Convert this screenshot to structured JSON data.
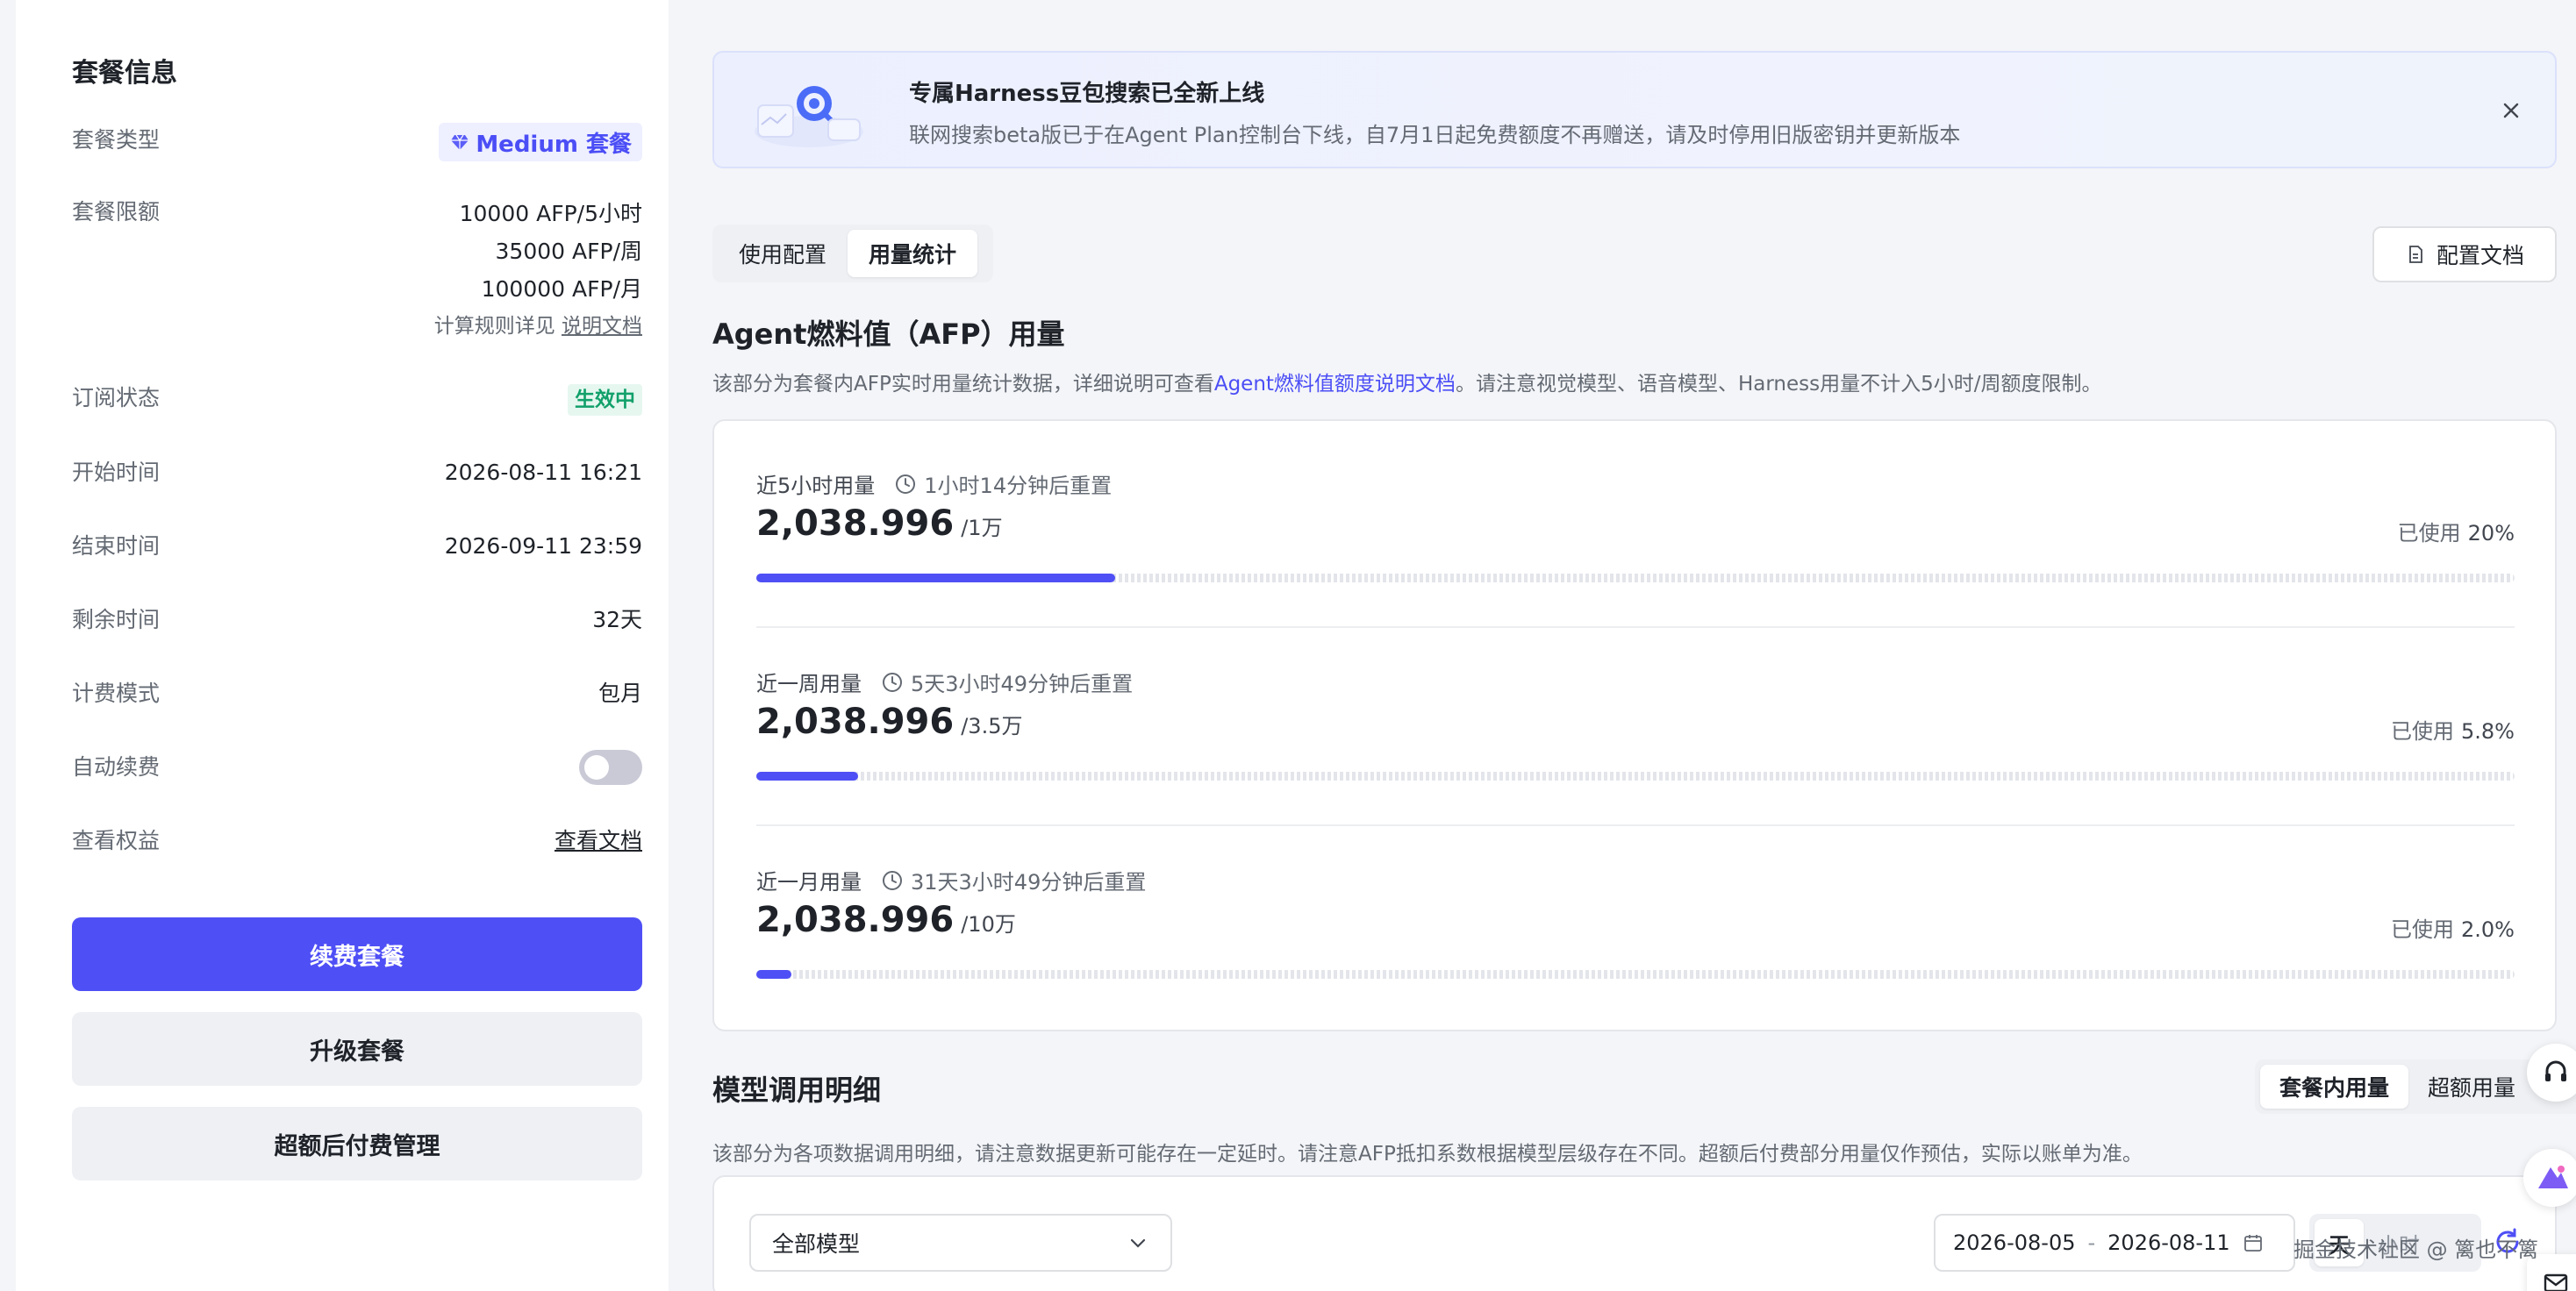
{
  "left": {
    "title": "套餐信息",
    "plan_type": {
      "label": "套餐类型",
      "value": "Medium 套餐"
    },
    "limits": {
      "label": "套餐限额",
      "lines": [
        "10000 AFP/5小时",
        "35000 AFP/周",
        "100000 AFP/月"
      ],
      "note_prefix": "计算规则详见",
      "note_link": "说明文档"
    },
    "subscription": {
      "label": "订阅状态",
      "value": "生效中"
    },
    "start_time": {
      "label": "开始时间",
      "value": "2026-08-11 16:21"
    },
    "end_time": {
      "label": "结束时间",
      "value": "2026-09-11 23:59"
    },
    "remaining": {
      "label": "剩余时间",
      "value": "32天"
    },
    "billing": {
      "label": "计费模式",
      "value": "包月"
    },
    "auto_renew": {
      "label": "自动续费",
      "enabled": false
    },
    "benefits": {
      "label": "查看权益",
      "link": "查看文档"
    },
    "buttons": {
      "renew": "续费套餐",
      "upgrade": "升级套餐",
      "overage": "超额后付费管理"
    }
  },
  "banner": {
    "title": "专属Harness豆包搜索已全新上线",
    "desc": "联网搜索beta版已于在Agent Plan控制台下线，自7月1日起免费额度不再赠送，请及时停用旧版密钥并更新版本"
  },
  "tabs": [
    "使用配置",
    "用量统计"
  ],
  "active_tab": "用量统计",
  "config_doc_button": "配置文档",
  "afp": {
    "title": "Agent燃料值（AFP）用量",
    "desc_prefix": "该部分为套餐内AFP实时用量统计数据，详细说明可查看",
    "desc_link": "Agent燃料值额度说明文档",
    "desc_suffix": "。请注意视觉模型、语音模型、Harness用量不计入5小时/周额度限制。",
    "items": [
      {
        "label": "近5小时用量",
        "reset": "1小时14分钟后重置",
        "value": "2,038.996",
        "unit": "/1万",
        "used_label": "已使用",
        "used": "20%",
        "fraction": 0.204
      },
      {
        "label": "近一周用量",
        "reset": "5天3小时49分钟后重置",
        "value": "2,038.996",
        "unit": "/3.5万",
        "used_label": "已使用",
        "used": "5.8%",
        "fraction": 0.058
      },
      {
        "label": "近一月用量",
        "reset": "31天3小时49分钟后重置",
        "value": "2,038.996",
        "unit": "/10万",
        "used_label": "已使用",
        "used": "2.0%",
        "fraction": 0.02
      }
    ]
  },
  "model_detail": {
    "title": "模型调用明细",
    "desc": "该部分为各项数据调用明细，请注意数据更新可能存在一定延时。请注意AFP抵扣系数根据模型层级存在不同。超额后付费部分用量仅作预估，实际以账单为准。",
    "segments": [
      "套餐内用量",
      "超额用量"
    ],
    "active_segment": "套餐内用量",
    "model_select": "全部模型",
    "date_start": "2026-08-05",
    "date_sep": "-",
    "date_end": "2026-08-11",
    "granularity": [
      "天",
      "小时"
    ]
  },
  "watermark": "掘金技术社区 @ 篱也不篱",
  "colors": {
    "accent": "#4f4ff6",
    "success": "#12a06a",
    "muted": "#646a73"
  }
}
